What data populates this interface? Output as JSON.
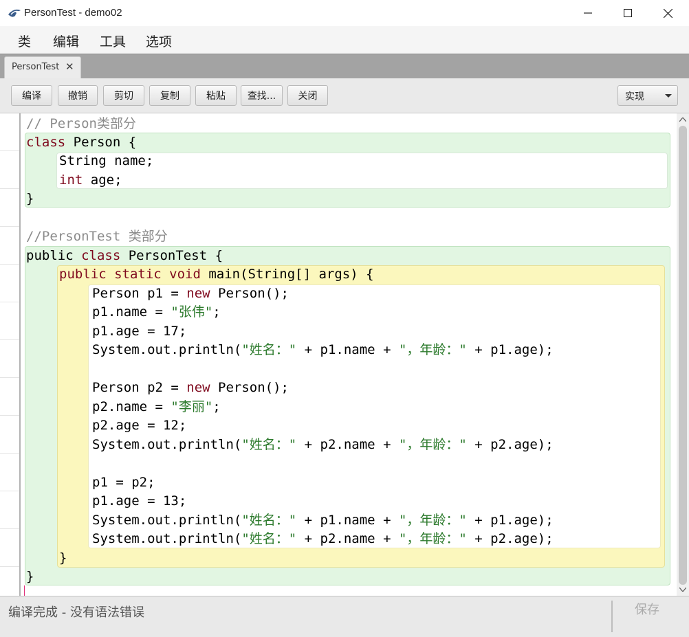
{
  "window": {
    "title": "PersonTest - demo02",
    "controls": {
      "minimize": "—",
      "maximize": "☐",
      "close": "✕"
    }
  },
  "menu": [
    "类",
    "编辑",
    "工具",
    "选项"
  ],
  "tabs": [
    {
      "label": "PersonTest",
      "close": "✕"
    }
  ],
  "toolbar": {
    "buttons": [
      "编译",
      "撤销",
      "剪切",
      "复制",
      "粘贴",
      "查找...",
      "关闭"
    ],
    "view_select": "实现"
  },
  "code": {
    "comment1": "// Person类部分",
    "class1_kw": "class",
    "class1_rest": " Person {",
    "field1": "String name;",
    "field2_kw": "int",
    "field2_rest": " age;",
    "class1_close": "}",
    "comment2": "//PersonTest 类部分",
    "class2_kw1": "public",
    "class2_kw2": "class",
    "class2_rest": " PersonTest {",
    "main_kw": "public static void",
    "main_rest": " main(String[] args) {",
    "lines": {
      "l1_a": "Person p1 = ",
      "l1_kw": "new",
      "l1_b": " Person();",
      "l2_a": "p1.name = ",
      "l2_str": "\"张伟\"",
      "l2_b": ";",
      "l3": "p1.age = 17;",
      "l4_a": "System.out.println(",
      "l4_s1": "\"姓名：\"",
      "l4_b": " + p1.name + ",
      "l4_s2": "\"，年龄：\"",
      "l4_c": " + p1.age);",
      "l6_a": "Person p2 = ",
      "l6_kw": "new",
      "l6_b": " Person();",
      "l7_a": "p2.name = ",
      "l7_str": "\"李丽\"",
      "l7_b": ";",
      "l8": "p2.age = 12;",
      "l9_a": "System.out.println(",
      "l9_s1": "\"姓名：\"",
      "l9_b": " + p2.name + ",
      "l9_s2": "\"，年龄：\"",
      "l9_c": " + p2.age);",
      "l11": "p1 = p2;",
      "l12": "p1.age = 13;",
      "l13_a": "System.out.println(",
      "l13_s1": "\"姓名：\"",
      "l13_b": " + p1.name + ",
      "l13_s2": "\"，年龄：\"",
      "l13_c": " + p1.age);",
      "l14_a": "System.out.println(",
      "l14_s1": "\"姓名：\"",
      "l14_b": " + p2.name + ",
      "l14_s2": "\"，年龄：\"",
      "l14_c": " + p2.age);"
    },
    "main_close": "}",
    "class2_close": "}"
  },
  "status": {
    "message": "编译完成 - 没有语法错误",
    "save": "保存"
  },
  "colors": {
    "keyword": "#7f0a1e",
    "string": "#2c7a2c",
    "comment": "#8c8c8c",
    "class_scope": "#e2f6e2",
    "method_scope": "#fbf7bd"
  }
}
